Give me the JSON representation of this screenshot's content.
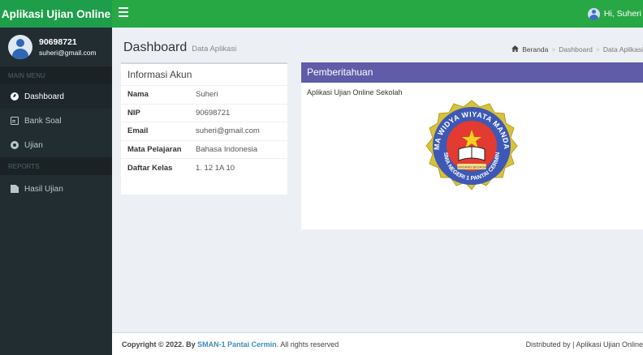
{
  "header": {
    "app_title": "Aplikasi Ujian Online",
    "user_greeting": "Hi, Suheri"
  },
  "sidebar": {
    "user_id": "90698721",
    "user_email": "suheri@gmail.com",
    "main_menu_header": "MAIN MENU",
    "reports_header": "REPORTS",
    "items": [
      {
        "label": "Dashboard",
        "icon": "dashboard-icon",
        "active": true
      },
      {
        "label": "Bank Soal",
        "icon": "file-text-icon",
        "active": false
      },
      {
        "label": "Ujian",
        "icon": "gear-icon",
        "active": false
      }
    ],
    "report_items": [
      {
        "label": "Hasil Ujian",
        "icon": "document-icon",
        "active": false
      }
    ]
  },
  "content_header": {
    "title": "Dashboard",
    "subtitle": "Data Aplikasi",
    "breadcrumb": [
      "Beranda",
      "Dashboard",
      "Data Aplikasi"
    ]
  },
  "info_box": {
    "title": "Informasi Akun",
    "rows": [
      {
        "key": "Nama",
        "value": "Suheri"
      },
      {
        "key": "NIP",
        "value": "90698721"
      },
      {
        "key": "Email",
        "value": "suheri@gmail.com"
      },
      {
        "key": "Mata Pelajaran",
        "value": "Bahasa Indonesia"
      },
      {
        "key": "Daftar Kelas",
        "value": "1. 12 1A 10"
      }
    ]
  },
  "notice_box": {
    "title": "Pemberitahuan",
    "text": "Aplikasi Ujian Online Sekolah",
    "seal_top_text": "ATMA WIDYA WIYATA MANDALA",
    "seal_bottom_text": "SMA NEGERI 1 PANTAI CERMIN",
    "seal_ribbon_text": "SERDANG BEDAGAI"
  },
  "footer": {
    "copyright_prefix": "Copyright © 2022. By ",
    "brand": "SMAN-1 Pantai Cermin",
    "copyright_suffix": ". All rights reserved",
    "distributed": "Distributed by | Aplikasi Ujian Online"
  },
  "colors": {
    "header_green": "#28a745",
    "logo_green": "#1e9e4a",
    "sidebar_dark": "#222d32",
    "notice_purple": "#605ca8",
    "footer_link": "#3c8dbc"
  }
}
